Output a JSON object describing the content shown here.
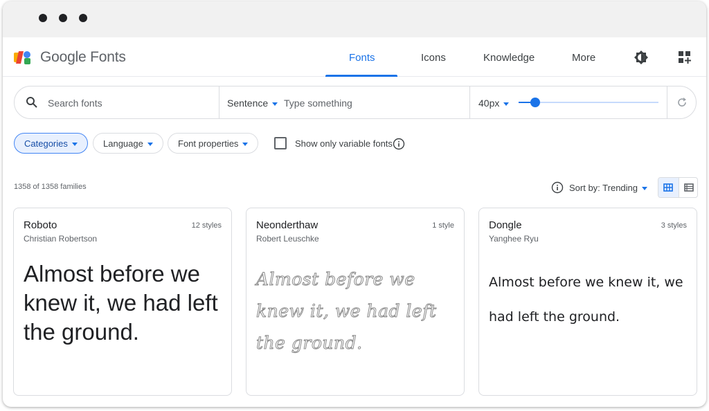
{
  "brand": {
    "google": "Google",
    "fonts": "Fonts"
  },
  "nav": {
    "items": [
      {
        "label": "Fonts",
        "active": true
      },
      {
        "label": "Icons"
      },
      {
        "label": "Knowledge"
      },
      {
        "label": "More"
      }
    ],
    "theme_icon": "brightness-icon",
    "apps_icon": "apps-icon"
  },
  "search": {
    "placeholder": "Search fonts",
    "preview_mode": "Sentence",
    "preview_placeholder": "Type something",
    "size": "40px",
    "slider_fraction": 0.12
  },
  "filters": {
    "categories": "Categories",
    "language": "Language",
    "font_properties": "Font properties",
    "variable_only": "Show only variable fonts",
    "variable_checked": false
  },
  "results": {
    "count": "1358 of 1358 families",
    "sort": "Sort by: Trending"
  },
  "cards": [
    {
      "name": "Roboto",
      "styles": "12 styles",
      "designer": "Christian Robertson",
      "sample": "Almost before we knew it, we had left the ground."
    },
    {
      "name": "Neonderthaw",
      "styles": "1 style",
      "designer": "Robert Leuschke",
      "sample": "Almost before we knew it, we had left the ground."
    },
    {
      "name": "Dongle",
      "styles": "3 styles",
      "designer": "Yanghee Ryu",
      "sample": "Almost before we knew it, we had left the ground."
    }
  ],
  "colors": {
    "accent": "#1a73e8",
    "selected_chip_bg": "#e8f0fe",
    "border": "#dadce0"
  }
}
